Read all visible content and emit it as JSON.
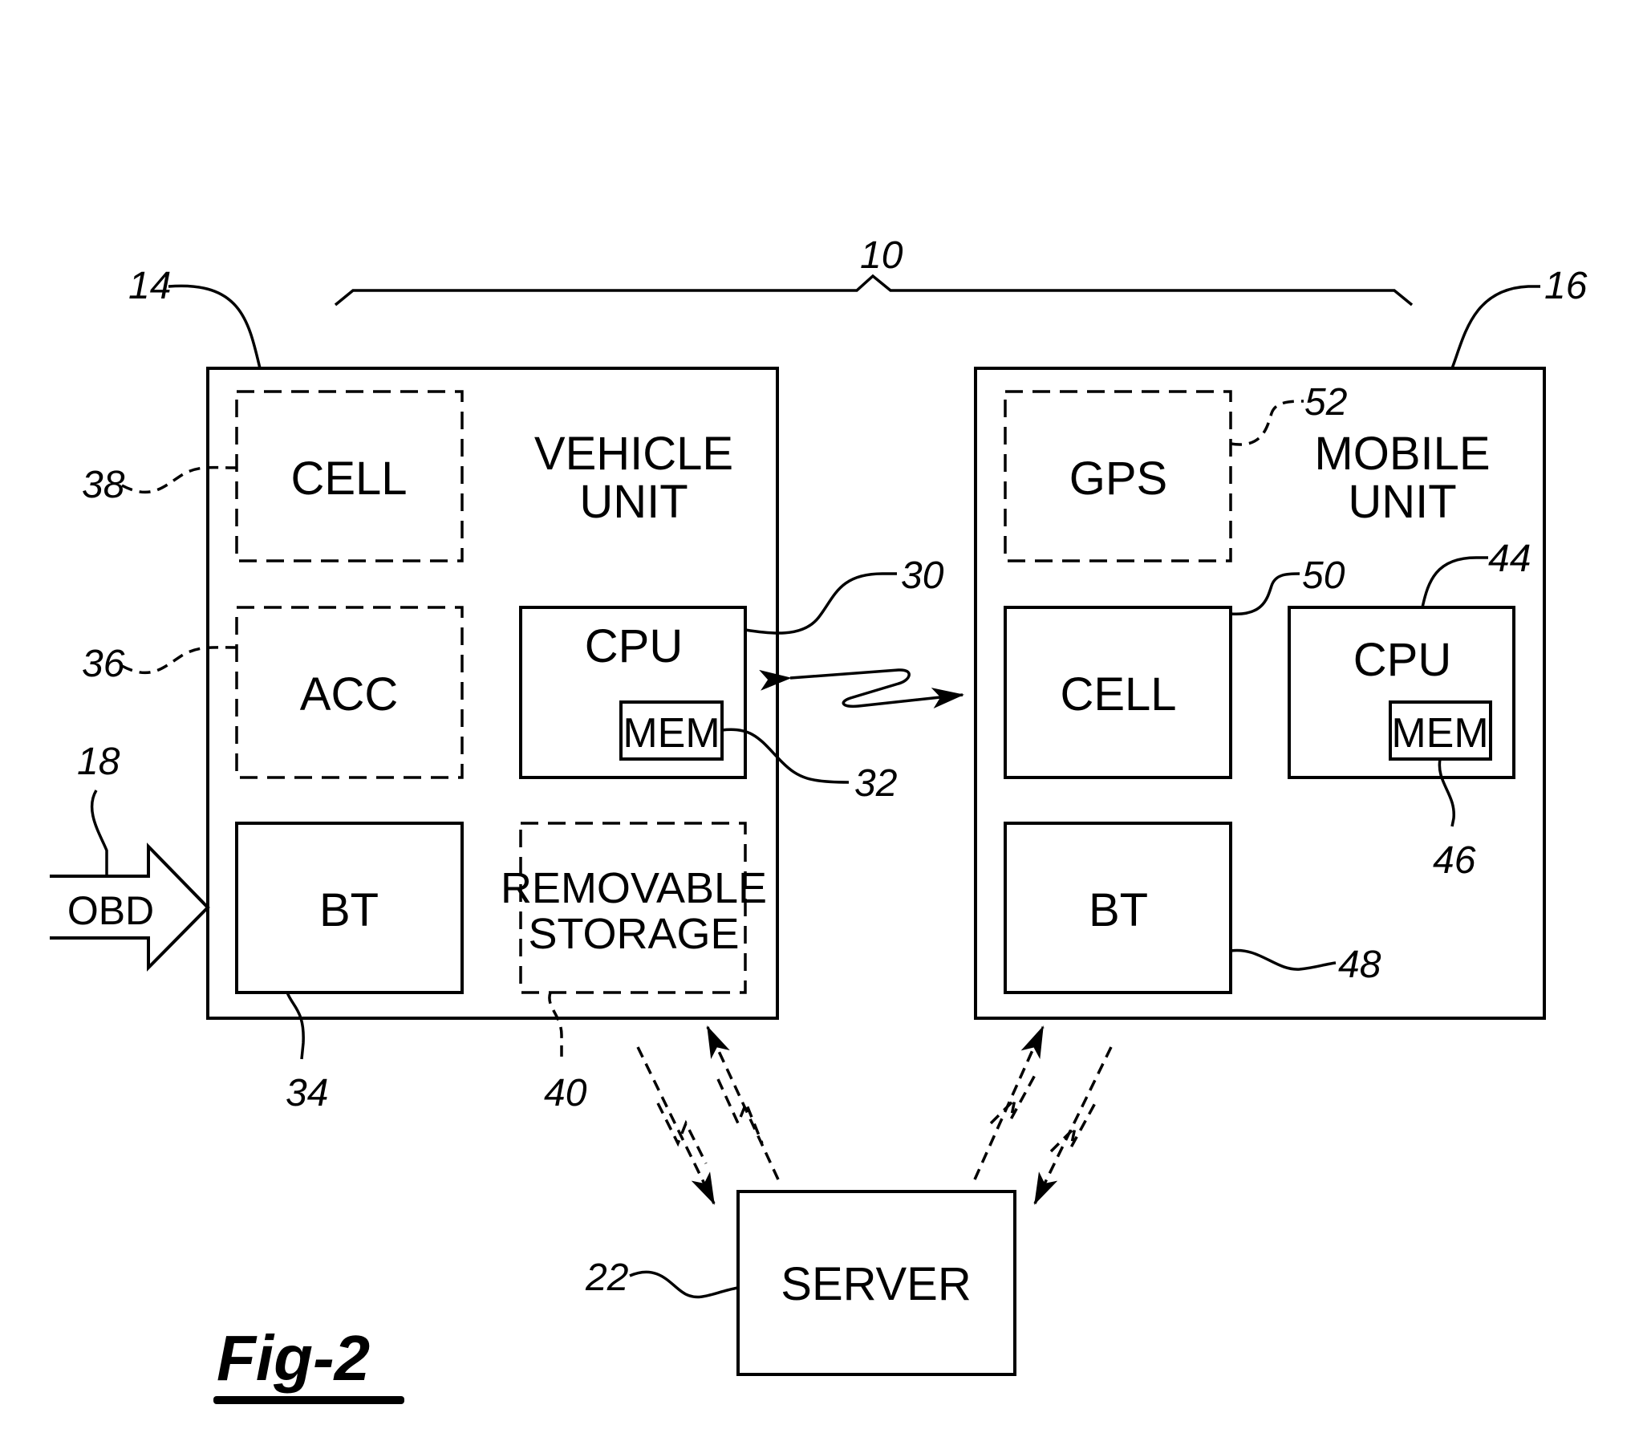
{
  "figure": {
    "title": "Fig-2"
  },
  "system_ref": "10",
  "vehicle_unit": {
    "ref": "14",
    "title_line1": "VEHICLE",
    "title_line2": "UNIT",
    "components": {
      "cell": {
        "label": "CELL",
        "ref": "38",
        "optional": true
      },
      "acc": {
        "label": "ACC",
        "ref": "36",
        "optional": true
      },
      "bt": {
        "label": "BT",
        "ref": "34",
        "optional": false
      },
      "cpu": {
        "label": "CPU",
        "ref": "30",
        "optional": false
      },
      "mem": {
        "label": "MEM",
        "ref": "32",
        "optional": false
      },
      "removable_storage": {
        "label_line1": "REMOVABLE",
        "label_line2": "STORAGE",
        "ref": "40",
        "optional": true
      }
    }
  },
  "obd": {
    "label": "OBD",
    "ref": "18"
  },
  "mobile_unit": {
    "ref": "16",
    "title_line1": "MOBILE",
    "title_line2": "UNIT",
    "components": {
      "gps": {
        "label": "GPS",
        "ref": "52",
        "optional": true
      },
      "cell": {
        "label": "CELL",
        "ref": "50",
        "optional": false
      },
      "cpu": {
        "label": "CPU",
        "ref": "44",
        "optional": false
      },
      "mem": {
        "label": "MEM",
        "ref": "46",
        "optional": false
      },
      "bt": {
        "label": "BT",
        "ref": "48",
        "optional": false
      }
    }
  },
  "server": {
    "label": "SERVER",
    "ref": "22"
  }
}
